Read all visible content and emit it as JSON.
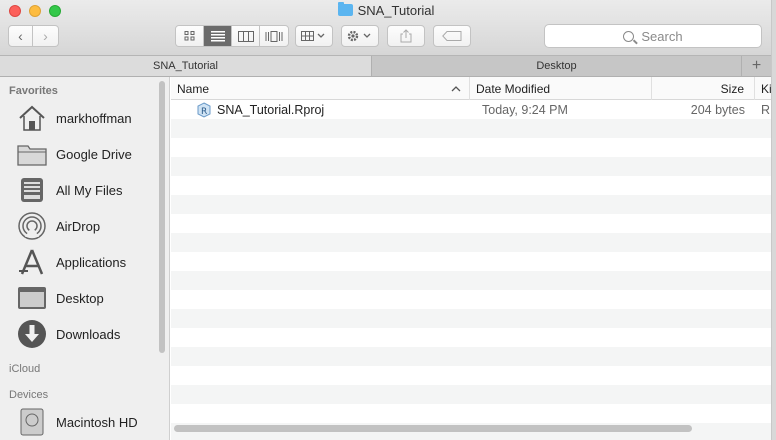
{
  "window": {
    "title": "SNA_Tutorial"
  },
  "toolbar": {
    "back_label": "‹",
    "forward_label": "›",
    "search_placeholder": "Search"
  },
  "tabs": [
    {
      "label": "SNA_Tutorial",
      "active": true
    },
    {
      "label": "Desktop",
      "active": false
    }
  ],
  "tab_add_label": "+",
  "sidebar": {
    "favorites_label": "Favorites",
    "favorites": [
      {
        "label": "markhoffman",
        "icon": "home-icon"
      },
      {
        "label": "Google Drive",
        "icon": "folder-icon"
      },
      {
        "label": "All My Files",
        "icon": "all-files-icon"
      },
      {
        "label": "AirDrop",
        "icon": "airdrop-icon"
      },
      {
        "label": "Applications",
        "icon": "applications-icon"
      },
      {
        "label": "Desktop",
        "icon": "desktop-icon"
      },
      {
        "label": "Downloads",
        "icon": "downloads-icon"
      }
    ],
    "icloud_label": "iCloud",
    "devices_label": "Devices",
    "devices": [
      {
        "label": "Macintosh HD",
        "icon": "harddrive-icon"
      }
    ]
  },
  "columns": {
    "name": "Name",
    "date": "Date Modified",
    "size": "Size",
    "kind": "Ki"
  },
  "files": [
    {
      "name": "SNA_Tutorial.Rproj",
      "date": "Today, 9:24 PM",
      "size": "204 bytes",
      "kind": "R",
      "icon": "rproj-icon"
    }
  ],
  "colors": {
    "folder_blue": "#5bb5f0",
    "close_red": "#fc605b",
    "minimize_yellow": "#fdbc40",
    "zoom_green": "#34c84a"
  }
}
